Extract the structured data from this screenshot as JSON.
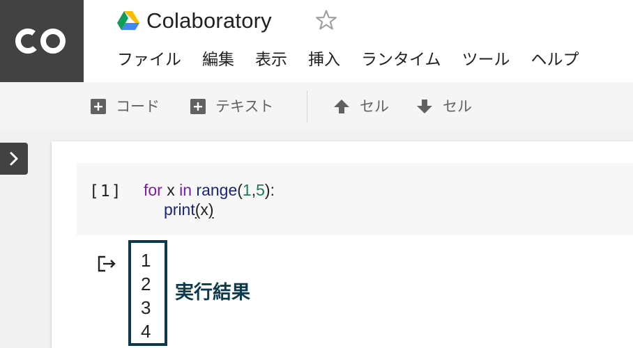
{
  "app": {
    "logo_text": "CO",
    "title": "Colaboratory",
    "star_icon": "star-outline-icon",
    "drive_icon": "google-drive-icon"
  },
  "menu": [
    "ファイル",
    "編集",
    "表示",
    "挿入",
    "ランタイム",
    "ツール",
    "ヘルプ"
  ],
  "toolbar": {
    "add_code_label": "コード",
    "add_text_label": "テキスト",
    "cell_up_label": "セル",
    "cell_down_label": "セル",
    "add_icon": "plus-box-icon",
    "up_icon": "arrow-up-icon",
    "down_icon": "arrow-down-icon"
  },
  "cell": {
    "exec_count": "[1]",
    "code": {
      "line1": {
        "kw_for": "for",
        "var": " x ",
        "kw_in": "in",
        "sp": " ",
        "fn_range": "range",
        "paren_open": "(",
        "n1": "1",
        "comma": ",",
        "n2": "5",
        "close": "):"
      },
      "line2": {
        "fn_print": "print",
        "paren_open": "(",
        "arg": "x",
        "paren_close": ")"
      }
    }
  },
  "output": {
    "icon": "output-redirect-icon",
    "lines": [
      "1",
      "2",
      "3",
      "4"
    ],
    "annotation": "実行結果"
  },
  "colors": {
    "logo_bg": "#424242",
    "toolbar_bg": "#f5f5f5",
    "keyword": "#7a1fa2",
    "builtin": "#1a237e",
    "number": "#1b7b5a",
    "annotation": "#0d3a4a"
  }
}
